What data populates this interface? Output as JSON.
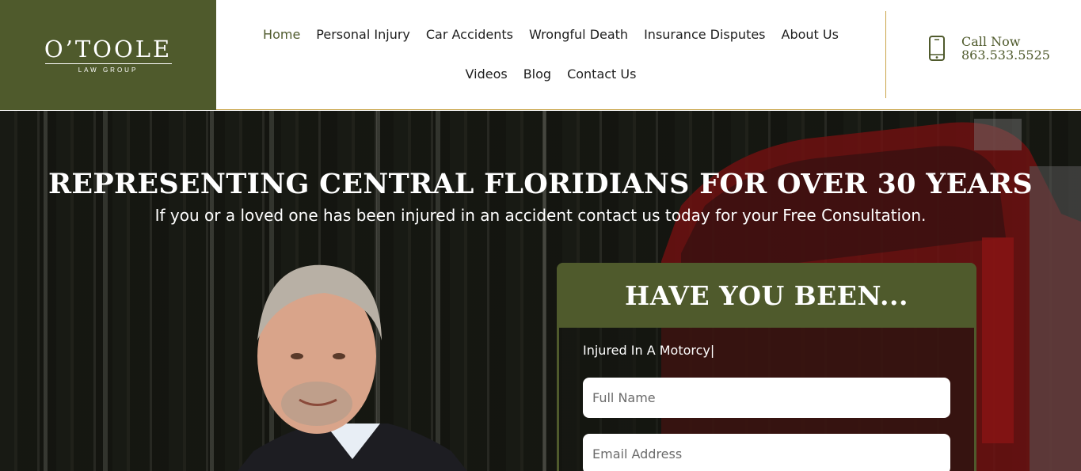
{
  "logo": {
    "name": "O’TOOLE",
    "tagline": "LAW GROUP"
  },
  "nav": {
    "row1": [
      "Home",
      "Personal Injury",
      "Car Accidents",
      "Wrongful Death",
      "Insurance Disputes",
      "About Us"
    ],
    "row2": [
      "Videos",
      "Blog",
      "Contact Us"
    ],
    "active": "Home"
  },
  "call": {
    "label": "Call Now",
    "phone": "863.533.5525",
    "icon": "phone-icon"
  },
  "hero": {
    "title": "REPRESENTING CENTRAL FLORIDIANS FOR OVER 30 YEARS",
    "subtitle": "If you or a loved one has been injured in an accident contact us today for your Free Consultation."
  },
  "form": {
    "title": "HAVE YOU BEEN...",
    "typed_text": "Injured In A Motorcy|",
    "fields": [
      {
        "placeholder": "Full Name"
      },
      {
        "placeholder": "Email Address"
      }
    ]
  },
  "colors": {
    "brand_green": "#4f5a2c",
    "accent_gold": "#c9a449",
    "truck_red": "#8a1414"
  }
}
